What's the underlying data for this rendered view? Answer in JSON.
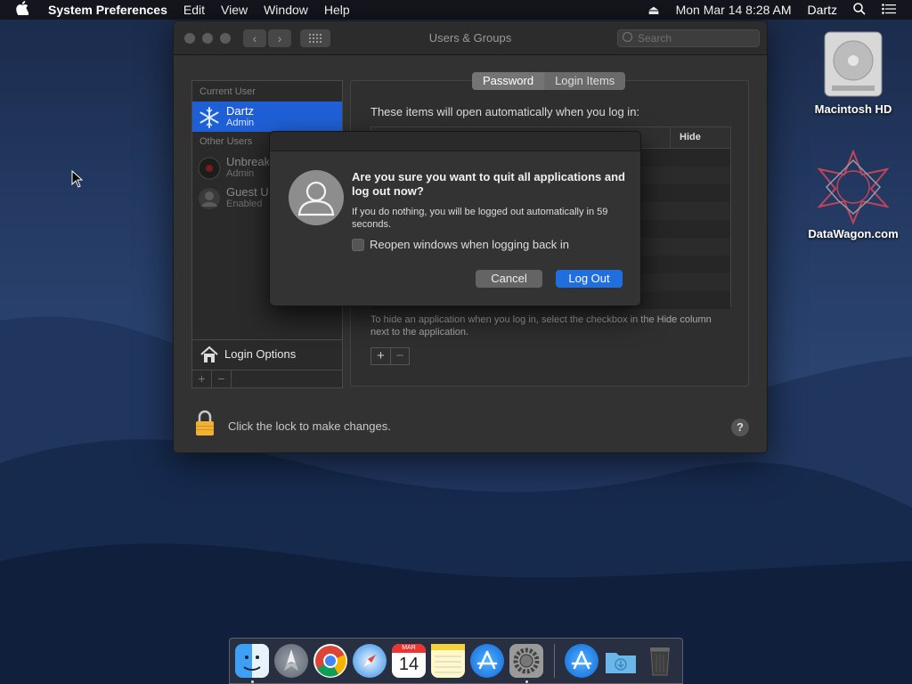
{
  "menubar": {
    "apple": "",
    "app_name": "System Preferences",
    "items": [
      "Edit",
      "View",
      "Window",
      "Help"
    ],
    "right": {
      "eject": "⏏",
      "clock": "Mon Mar 14  8:28 AM",
      "user": "Dartz"
    }
  },
  "window": {
    "title": "Users & Groups",
    "search_placeholder": "Search",
    "sidebar": {
      "current_users_header": "Current User",
      "current_user": {
        "name": "Dartz",
        "role": "Admin"
      },
      "other_users_header": "Other Users",
      "other_users": [
        {
          "name": "Unbreak",
          "role": "Admin"
        },
        {
          "name": "Guest U",
          "role": "Enabled"
        }
      ],
      "login_options": "Login Options",
      "add": "+",
      "remove": "−"
    },
    "tabs": [
      "Password",
      "Login Items"
    ],
    "selected_tab": "Password",
    "intro": "These items will open automatically when you log in:",
    "table_header_hide": "Hide",
    "hint": "To hide an application when you log in, select the checkbox in the Hide column next to the application.",
    "add": "+",
    "remove": "−",
    "lock_text": "Click the lock to make changes.",
    "help": "?"
  },
  "dialog": {
    "question": "Are you sure you want to quit all applications and log out now?",
    "subtext": "If you do nothing, you will be logged out automatically in 59 seconds.",
    "checkbox_label": "Reopen windows when logging back in",
    "checkbox_checked": false,
    "cancel": "Cancel",
    "confirm": "Log Out"
  },
  "desktop": {
    "icons": [
      {
        "name": "Macintosh HD"
      },
      {
        "name": "DataWagon.com"
      }
    ]
  },
  "dock": {
    "calendar_month": "MAR",
    "calendar_day": "14",
    "apps": [
      "Finder",
      "Launchpad",
      "Chrome",
      "Safari",
      "Calendar",
      "Notes",
      "App Store",
      "System Preferences",
      "App Store Downloads",
      "Downloads",
      "Trash"
    ]
  },
  "colors": {
    "accent": "#1f6fe0",
    "selection": "#1f5fd6"
  }
}
